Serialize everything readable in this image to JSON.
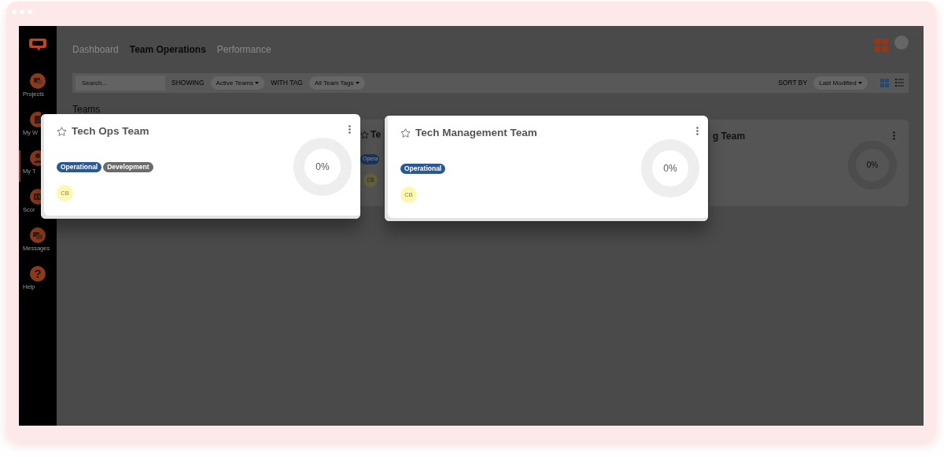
{
  "sidebar": {
    "items": [
      {
        "label": "Projects",
        "selected": false
      },
      {
        "label": "My W",
        "selected": false
      },
      {
        "label": "My T",
        "selected": true
      },
      {
        "label": "Scor",
        "selected": false
      },
      {
        "label": "Messages",
        "selected": false
      },
      {
        "glyph": "?",
        "label": "Help",
        "selected": false
      }
    ]
  },
  "tabs": [
    {
      "label": "Dashboard",
      "selected": false
    },
    {
      "label": "Team Operations",
      "selected": true
    },
    {
      "label": "Performance",
      "selected": false
    }
  ],
  "toolbar": {
    "search": {
      "placeholder": "Search..."
    },
    "filters": [
      {
        "label": "SHOWING",
        "value": "Active Teams"
      },
      {
        "label": "WITH TAG",
        "value": "All Team Tags"
      }
    ],
    "sort": {
      "label": "SORT BY",
      "value": "Last Modified"
    },
    "views": [
      {
        "kind": "grid",
        "selected": true
      },
      {
        "kind": "list",
        "selected": false
      }
    ]
  },
  "section_title": "Teams",
  "background_cards": [
    {
      "title": "Te",
      "tags": [
        {
          "label": "Opera",
          "color": "#1f3656"
        }
      ],
      "avatar": "CB"
    },
    {
      "title": "g Team",
      "percent": "0%"
    }
  ],
  "cards": [
    {
      "title": "Tech Ops Team",
      "favorite": false,
      "tags": [
        {
          "label": "Operational",
          "color": "#2b5894"
        },
        {
          "label": "Development",
          "color": "#6b6b6b"
        }
      ],
      "avatar": "CB",
      "percent": "0%"
    },
    {
      "title": "Tech Management Team",
      "favorite": false,
      "tags": [
        {
          "label": "Operational",
          "color": "#2b5894"
        }
      ],
      "avatar": "CB",
      "percent": "0%"
    }
  ]
}
